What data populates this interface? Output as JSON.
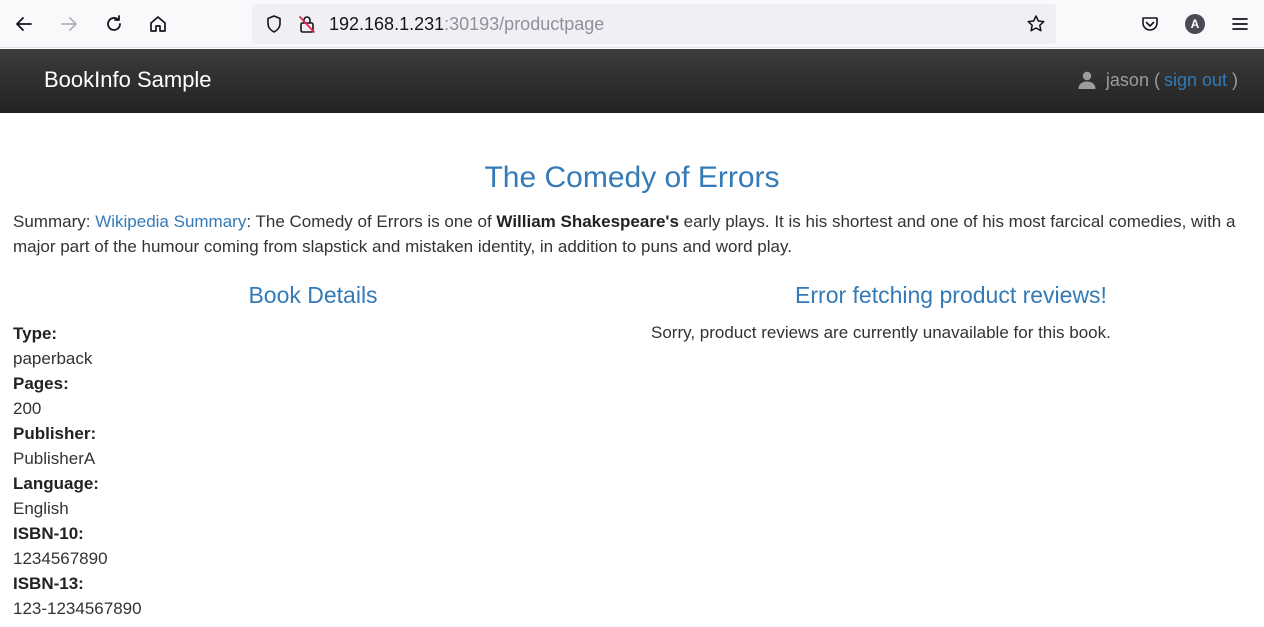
{
  "browser": {
    "url_host": "192.168.1.231",
    "url_rest": ":30193/productpage",
    "account_initial": "A"
  },
  "navbar": {
    "brand": "BookInfo Sample",
    "username": "jason",
    "open_paren": "(",
    "sign_out": "sign out",
    "close_paren": ")"
  },
  "product": {
    "title": "The Comedy of Errors",
    "summary_label": "Summary: ",
    "summary_link": "Wikipedia Summary",
    "summary_pre": ": The Comedy of Errors is one of ",
    "summary_bold": "William Shakespeare's",
    "summary_post": " early plays. It is his shortest and one of his most farcical comedies, with a major part of the humour coming from slapstick and mistaken identity, in addition to puns and word play."
  },
  "details": {
    "heading": "Book Details",
    "items": [
      {
        "label": "Type:",
        "value": "paperback"
      },
      {
        "label": "Pages:",
        "value": "200"
      },
      {
        "label": "Publisher:",
        "value": "PublisherA"
      },
      {
        "label": "Language:",
        "value": "English"
      },
      {
        "label": "ISBN-10:",
        "value": "1234567890"
      },
      {
        "label": "ISBN-13:",
        "value": "123-1234567890"
      }
    ]
  },
  "reviews": {
    "heading": "Error fetching product reviews!",
    "message": "Sorry, product reviews are currently unavailable for this book."
  }
}
